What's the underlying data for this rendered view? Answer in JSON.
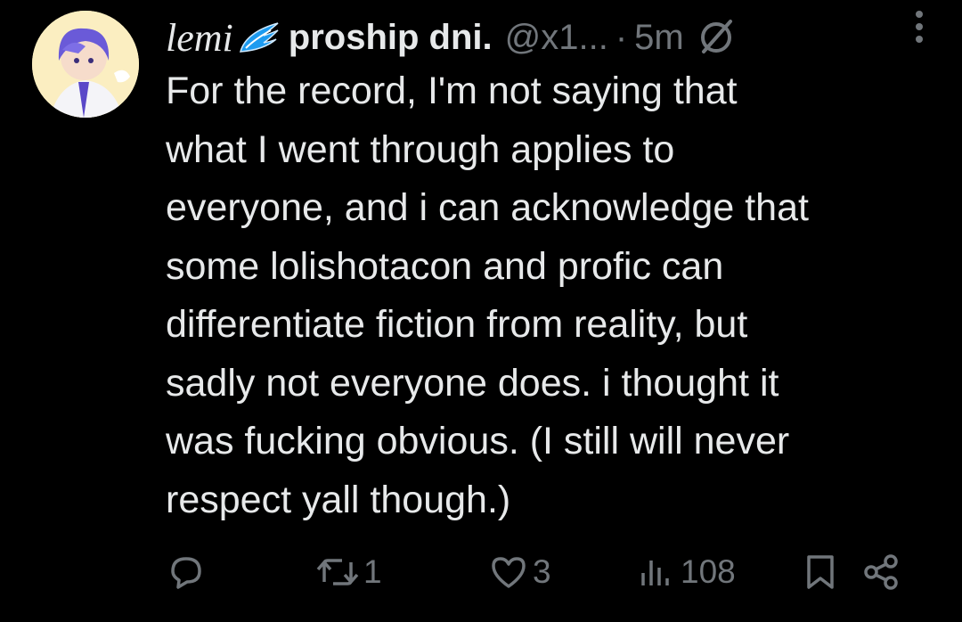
{
  "tweet": {
    "display_name": "lemi",
    "name_emoji_icon": "wing-icon",
    "name_rest": "proship dni.",
    "handle": "@x1...",
    "separator": "·",
    "time": "5m",
    "muted_icon": "mute-slash-icon",
    "more_icon": "more-vertical-icon",
    "text": "For the record, I'm not saying that\nwhat I went through applies to\neveryone, and i can acknowledge that\nsome lolishotacon and profic can\ndifferentiate fiction from reality, but\nsadly not everyone does. i thought it\nwas fucking obvious. (I still will never\nrespect yall though.)"
  },
  "actions": {
    "reply": {
      "icon": "reply-icon",
      "count": ""
    },
    "retweet": {
      "icon": "retweet-icon",
      "count": "1"
    },
    "like": {
      "icon": "heart-icon",
      "count": "3"
    },
    "views": {
      "icon": "views-icon",
      "count": "108"
    },
    "bookmark": {
      "icon": "bookmark-icon"
    },
    "share": {
      "icon": "share-icon"
    }
  },
  "colors": {
    "background": "#000000",
    "text": "#e7e9ea",
    "secondary": "#71767b",
    "wing": "#1d9bf0"
  }
}
